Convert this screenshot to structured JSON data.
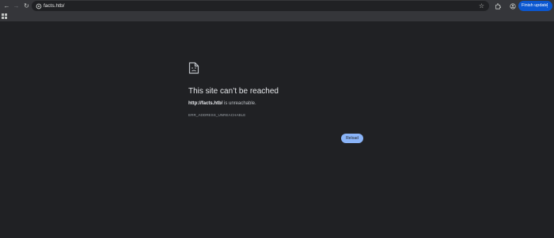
{
  "toolbar": {
    "url": "facts.htb/",
    "finish_update_label": "Finish update"
  },
  "error": {
    "title": "This site can’t be reached",
    "host": "http://facts.htb/",
    "description_suffix": " is unreachable.",
    "code": "ERR_ADDRESS_UNREACHABLE",
    "reload_label": "Reload"
  },
  "icons": [
    "back-icon",
    "forward-icon",
    "refresh-icon",
    "site-info-icon",
    "star-icon",
    "extensions-icon",
    "profile-icon",
    "menu-icon",
    "apps-icon",
    "sad-page-icon"
  ],
  "colors": {
    "background": "#202124",
    "toolbar": "#35363a",
    "accent": "#0b57d0",
    "reload": "#8ab4f8"
  }
}
